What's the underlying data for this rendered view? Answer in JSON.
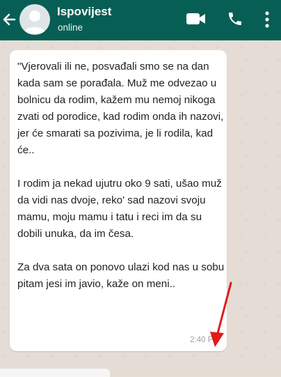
{
  "header": {
    "title": "Ispovijest",
    "status": "online"
  },
  "message": {
    "text": "\"Vjerovali ili ne, posvađali smo se na dan kada sam se porađala. Muž me odvezao u bolnicu da rodim, kažem mu nemoj nikoga zvati od porodice, kad rodim onda ih nazovi, jer će smarati sa pozivima, je li rodila, kad će..\n\nI rodim ja nekad ujutru oko 9 sati, ušao muž da vidi nas dvoje, reko' sad nazovi svoju mamu, moju mamu i tatu i reci im da su dobili unuka, da im česa.\n\nZa dva sata on ponovo ulazi kod nas u sobu pitam jesi im javio, kaže on meni..",
    "time": "2:40 PM"
  },
  "colors": {
    "header_bg": "#075e54",
    "chat_bg": "#e5ddd5",
    "bubble_bg": "#ffffff",
    "annotation_arrow": "#e11a1a"
  },
  "icons": [
    "back-arrow-icon",
    "avatar-placeholder-icon",
    "video-call-icon",
    "phone-call-icon",
    "more-vertical-icon",
    "annotation-arrow"
  ]
}
